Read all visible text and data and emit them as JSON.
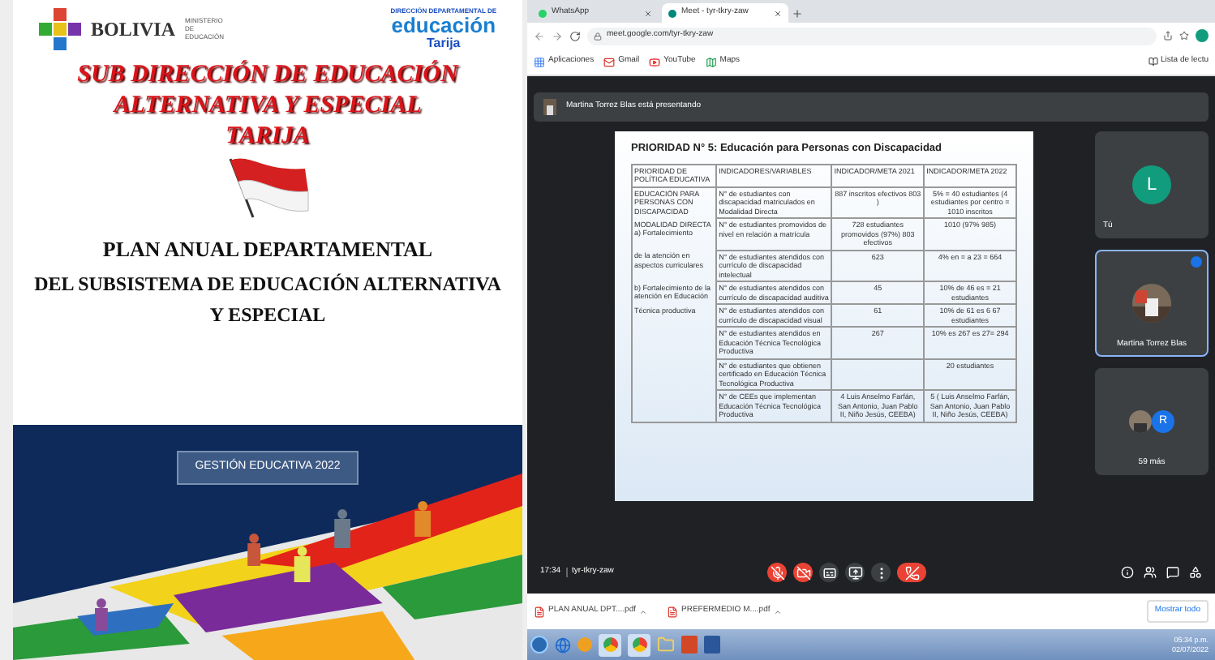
{
  "document": {
    "header": {
      "country": "BOLIVIA",
      "ministry": "MINISTERIO DE EDUCACIÓN",
      "dept_logo": {
        "line_1": "DIRECCIÓN DEPARTAMENTAL DE",
        "line_2": "educación",
        "line_3": "Tarija"
      }
    },
    "title_lines": [
      "SUB DIRECCIÓN DE EDUCACIÓN",
      "ALTERNATIVA Y ESPECIAL",
      "TARIJA"
    ],
    "subtitle_1": "PLAN ANUAL DEPARTAMENTAL",
    "subtitle_2": "DEL SUBSISTEMA DE EDUCACIÓN ALTERNATIVA Y ESPECIAL",
    "cover": {
      "kind": "picture",
      "label": "GESTIÓN EDUCATIVA 2022"
    }
  },
  "browser": {
    "tabs": [
      {
        "label": "WhatsApp",
        "selected": false
      },
      {
        "label": "Meet - tyr-tkry-zaw",
        "selected": true
      }
    ],
    "address": "meet.google.com/tyr-tkry-zaw",
    "bookmarks": [
      "Aplicaciones",
      "Gmail",
      "YouTube",
      "Maps"
    ],
    "reading_list": "Lista de lectu",
    "meet": {
      "banner": "Martina Torrez Blas está presentando",
      "slide": {
        "title": "PRIORIDAD N° 5: Educación para Personas con Discapacidad",
        "columns": [
          "PRIORIDAD DE POLÍTICA EDUCATIVA",
          "INDICADORES/VARIABLES",
          "INDICADOR/META 2021",
          "INDICADOR/META 2022"
        ],
        "rows": [
          [
            "EDUCACIÓN PARA PERSONAS CON DISCAPACIDAD",
            "N° de estudiantes con discapacidad matriculados en Modalidad Directa",
            "887 inscritos efectivos 803 )",
            "5% = 40 estudiantes (4 estudiantes por centro = 1010 inscritos"
          ],
          [
            "MODALIDAD DIRECTA a) Fortalecimiento",
            "N° de estudiantes promovidos de nivel en relación a matrícula",
            "728 estudiantes promovidos (97%) 803 efectivos",
            "1010 (97% 985)"
          ],
          [
            "de la atención en aspectos curriculares",
            "N° de estudiantes atendidos con currículo de discapacidad intelectual",
            "623",
            "4% en = a 23 = 664"
          ],
          [
            "b) Fortalecimiento de la atención en Educación",
            "N° de estudiantes atendidos con currículo de discapacidad auditiva",
            "45",
            "10% de 46 es = 21 estudiantes"
          ],
          [
            "Técnica productiva",
            "N° de estudiantes atendidos con currículo de discapacidad visual",
            "61",
            "10% de 61 es 6 67 estudiantes"
          ],
          [
            "",
            "N° de estudiantes atendidos en Educación Técnica Tecnológica Productiva",
            "267",
            "10% es 267 es 27= 294"
          ],
          [
            "",
            "N° de estudiantes que obtienen certificado en Educación Técnica Tecnológica Productiva",
            "",
            "20 estudiantes"
          ],
          [
            "",
            "N° de CEEs que implementan Educación Técnica Tecnológica Productiva",
            "4 Luis Anselmo Farfán, San Antonio, Juan Pablo II, Niño Jesús, CEEBA)",
            "5 ( Luis Anselmo Farfán, San Antonio, Juan Pablo II, Niño Jesús, CEEBA)"
          ]
        ]
      },
      "participants": [
        {
          "kind": "initial",
          "initial": "L",
          "name": "Tú",
          "selected": false
        },
        {
          "name": "Martina Torrez Blas",
          "selected": true
        },
        {
          "kind": "more",
          "initial": "R",
          "name": "59 más",
          "selected": false
        }
      ],
      "time": "17:34",
      "code": "tyr-tkry-zaw",
      "controls": [
        {
          "kind": "mic",
          "on": false
        },
        {
          "kind": "camera",
          "on": false
        },
        {
          "kind": "captions"
        },
        {
          "kind": "present"
        },
        {
          "kind": "more"
        },
        {
          "kind": "hangup"
        }
      ]
    },
    "downloads": [
      "PLAN ANUAL DPT....pdf",
      "PREFERMEDIO M....pdf"
    ],
    "show_all": "Mostrar todo"
  },
  "taskbar": {
    "time": "05:34 p.m.",
    "date": "02/07/2022"
  }
}
